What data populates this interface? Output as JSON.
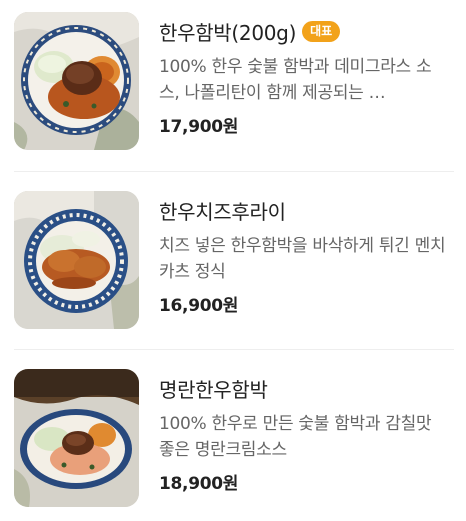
{
  "colors": {
    "badge_bg": "#f2a21a",
    "title_text": "#222222",
    "desc_text": "#666666",
    "divider": "#eeeeee"
  },
  "menu": {
    "items": [
      {
        "name": "한우함박(200g)",
        "badge": "대표",
        "desc": "100% 한우 숯불 함박과 데미그라스 소스, 나폴리탄이 함께 제공되는 …",
        "price": "17,900원",
        "image_icon": "hamburg-steak-plate-photo"
      },
      {
        "name": "한우치즈후라이",
        "badge": "",
        "desc": "치즈 넣은 한우함박을 바삭하게 튀긴 멘치카츠 정식",
        "price": "16,900원",
        "image_icon": "menchi-katsu-plate-photo"
      },
      {
        "name": "명란한우함박",
        "badge": "",
        "desc": "100% 한우로 만든 숯불 함박과 감칠맛 좋은 명란크림소스",
        "price": "18,900원",
        "image_icon": "mentaiko-hamburg-plate-photo"
      }
    ]
  }
}
